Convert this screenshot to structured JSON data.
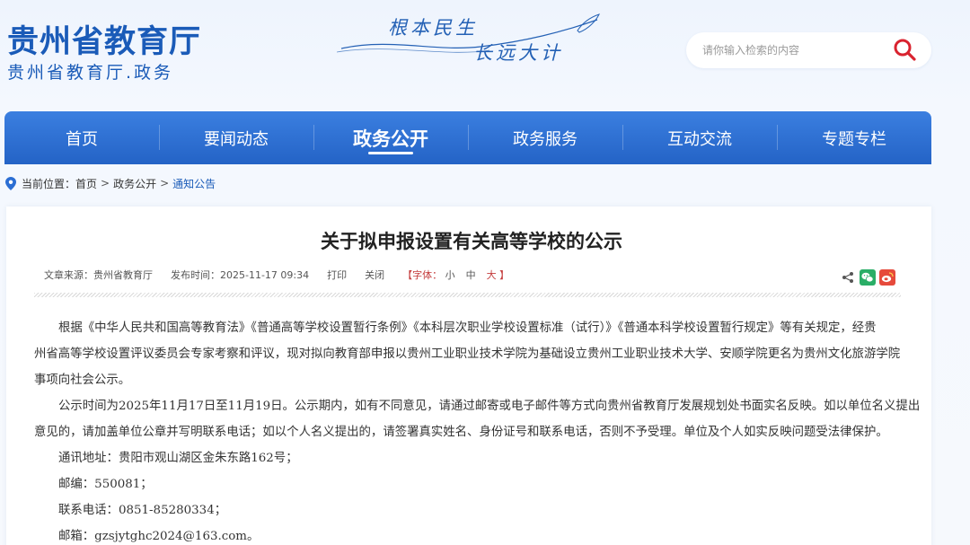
{
  "header": {
    "logo_title": "贵州省教育厅",
    "logo_subtitle": "贵州省教育厅.政务",
    "slogan_line1": "根本民生",
    "slogan_line2": "长远大计",
    "search_placeholder": "请你输入检索的内容",
    "search_icon": "search-icon"
  },
  "nav": {
    "items": [
      {
        "label": "首页"
      },
      {
        "label": "要闻动态"
      },
      {
        "label": "政务公开"
      },
      {
        "label": "政务服务"
      },
      {
        "label": "互动交流"
      },
      {
        "label": "专题专栏"
      }
    ],
    "active_label": "政务公开"
  },
  "breadcrumb": {
    "prefix": "当前位置：",
    "items": [
      "首页",
      "政务公开",
      "通知公告"
    ],
    "separator": ">",
    "icon": "location-pin-icon"
  },
  "article": {
    "title": "关于拟申报设置有关高等学校的公示",
    "source": "文章来源：贵州省教育厅",
    "publish_time": "发布时间：2025-11-17 09:34",
    "print_label": "打印",
    "close_label": "关闭",
    "font_size_prefix": "【字体：",
    "font_small": "小",
    "font_medium": "中",
    "font_large": "大",
    "font_size_suffix": "】",
    "share_icons": [
      "share-icon",
      "wechat-icon",
      "weibo-icon"
    ],
    "paragraph_1_lines": [
      "根据《中华人民共和国高等教育法》《普通高等学校设置暂行条例》《本科层次职业学校设置标准（试行）》《普通本科学校设置暂行规定》等有关规定，经贵",
      "州省高等学校设置评议委员会专家考察和评议，现对拟向教育部申报以贵州工业职业技术学院为基础设立贵州工业职业技术大学、安顺学院更名为贵州文化旅游学院",
      "事项向社会公示。"
    ],
    "paragraph_2_lines": [
      "公示时间为2025年11月17日至11月19日。公示期内，如有不同意见，请通过邮寄或电子邮件等方式向贵州省教育厅发展规划处书面实名反映。如以单位名义提出",
      "意见的，请加盖单位公章并写明联系电话；如以个人名义提出的，请签署真实姓名、身份证号和联系电话，否则不予受理。单位及个人如实反映问题受法律保护。"
    ],
    "address": "通讯地址：贵阳市观山湖区金朱东路162号；",
    "postcode": "邮编：550081；",
    "phone": "联系电话：0851-85280334；",
    "email": "邮箱：gzsjytghc2024@163.com。"
  },
  "colors": {
    "brand_blue": "#1a5bb8",
    "nav_blue": "#2b6ed3",
    "search_red": "#d9232f",
    "wechat_green": "#2aae67",
    "weibo_red": "#e64a3b"
  }
}
